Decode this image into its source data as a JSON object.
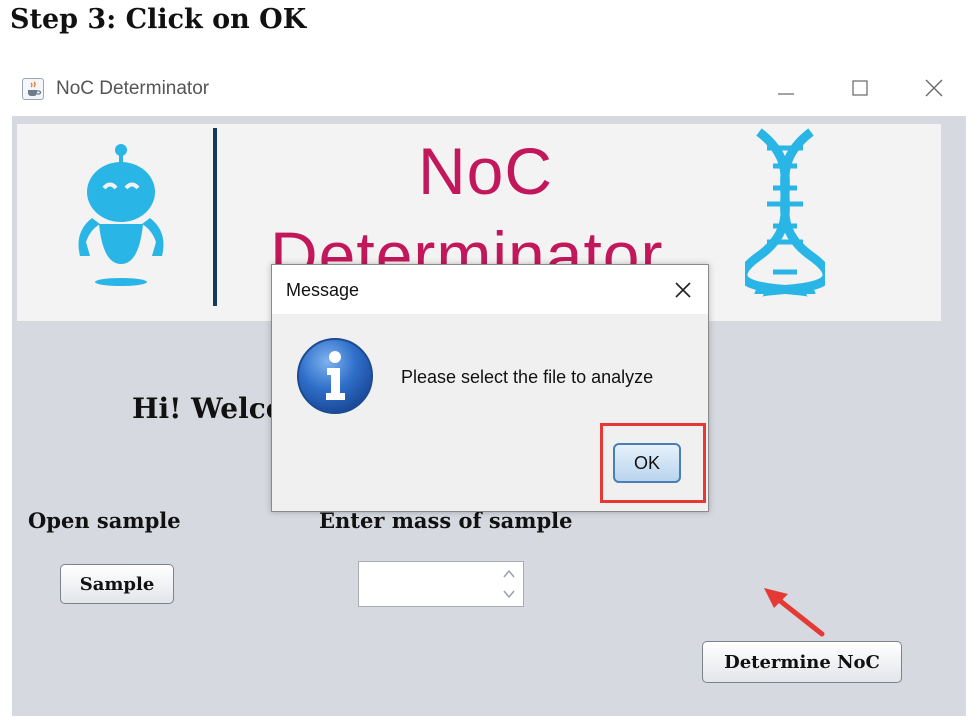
{
  "step_heading": "Step 3: Click on OK",
  "window": {
    "title": "NoC Determinator",
    "app_icon": "java-cup-icon",
    "controls": [
      "minimize-icon",
      "maximize-icon",
      "close-icon"
    ]
  },
  "banner": {
    "line1": "NoC",
    "line2": "Determinator",
    "left_graphic": "robot-icon",
    "right_graphic": "dna-icon",
    "title_color": "#c2185b",
    "icon_color": "#29b6e6"
  },
  "main": {
    "welcome_text": "Hi! Welcome to NoC Determinator!",
    "open_sample_label": "Open sample",
    "sample_button": "Sample",
    "mass_label": "Enter mass of sample",
    "mass_value": "",
    "determine_button": "Determine NoC"
  },
  "dialog": {
    "title": "Message",
    "icon": "info-icon",
    "message": "Please select the file to analyze",
    "ok_button": "OK"
  },
  "annotation": {
    "highlight_color": "#e53935",
    "arrow": "red-arrow-icon"
  }
}
